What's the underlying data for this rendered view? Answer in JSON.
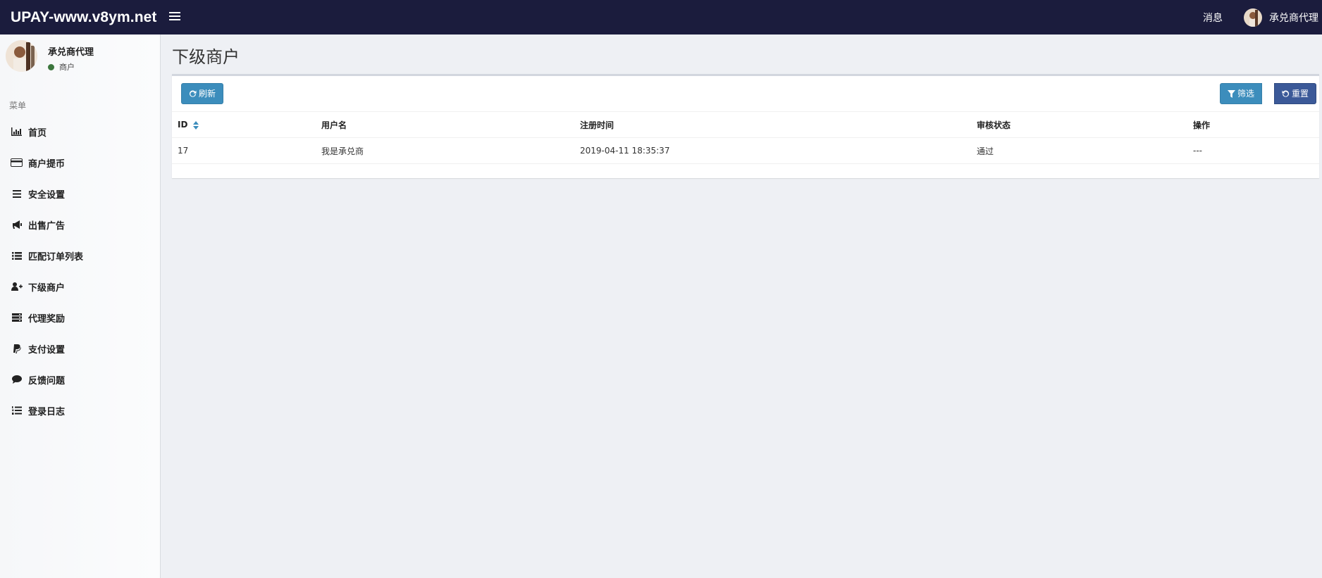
{
  "header": {
    "brand": "UPAY-www.v8ym.net",
    "messages_label": "消息",
    "user_name": "承兑商代理"
  },
  "sidebar": {
    "user_name": "承兑商代理",
    "user_role": "商户",
    "menu_header": "菜单",
    "items": [
      {
        "label": "首页",
        "icon": "bar-chart-icon"
      },
      {
        "label": "商户提币",
        "icon": "credit-card-icon"
      },
      {
        "label": "安全设置",
        "icon": "bars-icon"
      },
      {
        "label": "出售广告",
        "icon": "bullhorn-icon"
      },
      {
        "label": "匹配订单列表",
        "icon": "list-icon"
      },
      {
        "label": "下级商户",
        "icon": "user-plus-icon"
      },
      {
        "label": "代理奖励",
        "icon": "server-icon"
      },
      {
        "label": "支付设置",
        "icon": "paypal-icon"
      },
      {
        "label": "反馈问题",
        "icon": "comment-icon"
      },
      {
        "label": "登录日志",
        "icon": "list-ol-icon"
      }
    ]
  },
  "main": {
    "page_title": "下级商户",
    "toolbar": {
      "refresh_label": "刷新",
      "filter_label": "筛选",
      "reset_label": "重置"
    },
    "table": {
      "columns": [
        "ID",
        "用户名",
        "注册时间",
        "审核状态",
        "操作"
      ],
      "rows": [
        [
          "17",
          "我是承兑商",
          "2019-04-11 18:35:37",
          "通过",
          "---"
        ]
      ]
    }
  },
  "colors": {
    "topbar": "#1b1c3d",
    "primary_button": "#3c8dbc",
    "reset_button": "#3b5998",
    "status_online": "#3c763d"
  }
}
